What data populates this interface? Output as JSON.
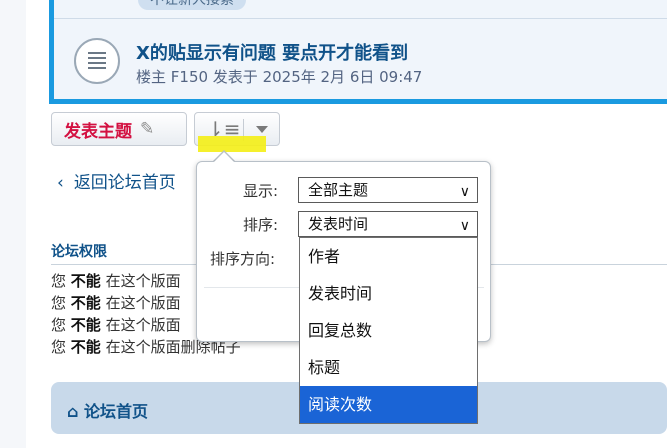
{
  "topic": {
    "tag": "不让新人接索",
    "title": "X的贴显示有问题 要点开才能看到",
    "meta": "楼主 F150 发表于 2025年 2月 6日 09:47"
  },
  "toolbar": {
    "post_label": "发表主题",
    "pencil_icon": "✎",
    "sort_icon": "⇂≡"
  },
  "back": {
    "label": "返回论坛首页",
    "icon": "‹"
  },
  "permissions": {
    "title": "论坛权限",
    "lines": [
      {
        "pre": "您",
        "strong": "不能",
        "text": "在这个版面"
      },
      {
        "pre": "您",
        "strong": "不能",
        "text": "在这个版面"
      },
      {
        "pre": "您",
        "strong": "不能",
        "text": "在这个版面"
      },
      {
        "pre": "您",
        "strong": "不能",
        "text": "在这个版面删除帖子"
      }
    ]
  },
  "footer": {
    "home_label": "论坛首页",
    "home_icon": "⌂"
  },
  "sort_popup": {
    "show_label": "显示:",
    "show_value": "全部主题",
    "sort_label": "排序:",
    "sort_value": "发表时间",
    "dir_label": "排序方向:",
    "options": [
      "作者",
      "发表时间",
      "回复总数",
      "标题",
      "阅读次数"
    ],
    "highlighted_option": "阅读次数"
  },
  "colors": {
    "accent": "#1a9ae0",
    "link": "#105289",
    "post_button": "#d31141",
    "highlight": "#f4ee16",
    "option_selected": "#1a64d6"
  }
}
